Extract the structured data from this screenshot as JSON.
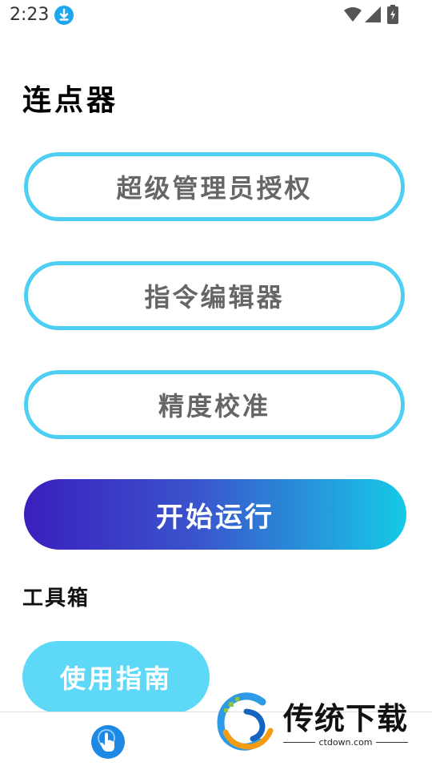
{
  "status_bar": {
    "time": "2:23",
    "icons": [
      "download-icon",
      "wifi-icon",
      "signal-icon",
      "battery-charging-icon"
    ]
  },
  "app": {
    "title": "连点器"
  },
  "buttons": {
    "admin_auth": "超级管理员授权",
    "command_editor": "指令编辑器",
    "precision_calibration": "精度校准",
    "start_run": "开始运行"
  },
  "toolbox": {
    "title": "工具箱",
    "guide_button": "使用指南"
  },
  "bottom_nav": {
    "icon": "tap-hand-icon"
  },
  "watermark": {
    "name": "传统下载",
    "domain": "ctdown.com"
  },
  "colors": {
    "outline_accent": "#4ccff2",
    "gradient_start": "#3a1fbe",
    "gradient_end": "#16cae6",
    "guide_button": "#5dd8f7",
    "nav_icon": "#1e88e5"
  }
}
